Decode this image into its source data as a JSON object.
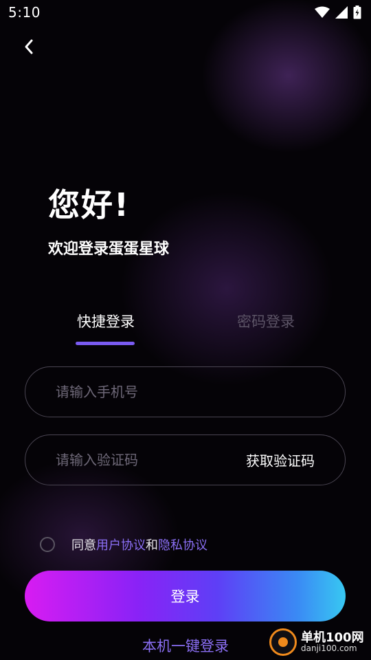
{
  "status_bar": {
    "time": "5:10",
    "icons": [
      "wifi-icon",
      "signal-icon",
      "battery-charging-icon"
    ]
  },
  "header": {
    "greeting": "您好!",
    "welcome": "欢迎登录蛋蛋星球"
  },
  "tabs": [
    {
      "label": "快捷登录",
      "active": true
    },
    {
      "label": "密码登录",
      "active": false
    }
  ],
  "form": {
    "phone_placeholder": "请输入手机号",
    "phone_value": "",
    "code_placeholder": "请输入验证码",
    "code_value": "",
    "get_code_label": "获取验证码"
  },
  "agreement": {
    "prefix": "同意",
    "user_agreement": "用户协议",
    "conjunction": "和",
    "privacy_policy": "隐私协议",
    "checked": false
  },
  "login_button": "登录",
  "one_key_login": "本机一键登录",
  "watermark": {
    "name": "单机100网",
    "url": "danji100.com"
  },
  "colors": {
    "accent": "#7a5bf2",
    "link": "#8b6ff5",
    "gradient_start": "#d81cf2",
    "gradient_end": "#38c8f2"
  }
}
